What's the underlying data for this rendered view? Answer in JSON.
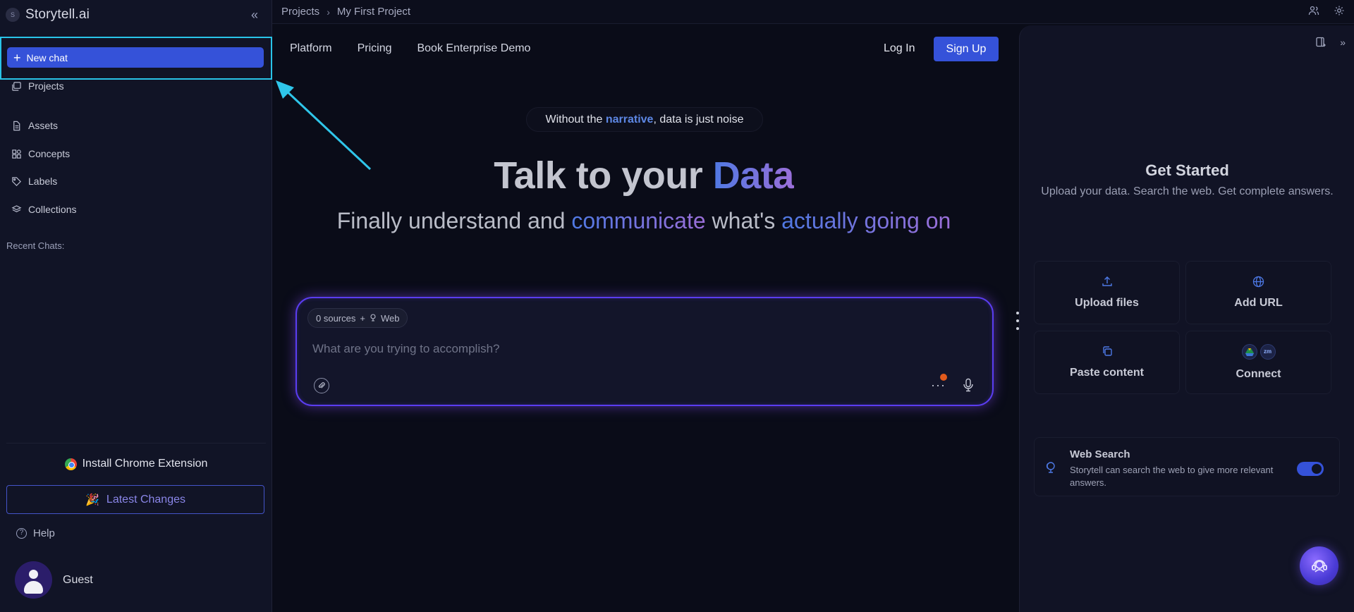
{
  "app": {
    "name": "Storytell.ai",
    "logo_text": "S"
  },
  "sidebar": {
    "new_chat_label": "New chat",
    "items": [
      {
        "label": "Projects",
        "icon": "folders-icon"
      },
      {
        "label": "Assets",
        "icon": "document-icon"
      },
      {
        "label": "Concepts",
        "icon": "grid-icon"
      },
      {
        "label": "Labels",
        "icon": "tag-icon"
      },
      {
        "label": "Collections",
        "icon": "layers-icon"
      }
    ],
    "recent_chats_label": "Recent Chats:",
    "chrome_extension_label": "Install Chrome Extension",
    "latest_changes_label": "Latest Changes",
    "latest_changes_emoji": "🎉",
    "help_label": "Help",
    "user_name": "Guest"
  },
  "breadcrumb": {
    "root": "Projects",
    "current": "My First Project"
  },
  "main_nav": {
    "items": [
      "Platform",
      "Pricing",
      "Book Enterprise Demo"
    ],
    "login": "Log In",
    "signup": "Sign Up"
  },
  "hero": {
    "pill_prefix": "Without the ",
    "pill_highlight": "narrative",
    "pill_suffix": ", data is just noise",
    "title_prefix": "Talk to your ",
    "title_highlight": "Data",
    "subtitle_part1": "Finally understand and ",
    "subtitle_hl1": "communicate",
    "subtitle_part2": " what's ",
    "subtitle_hl2": "actually going on"
  },
  "composer": {
    "sources_count": "0 sources",
    "sources_plus": "+",
    "sources_web": "Web",
    "placeholder": "What are you trying to accomplish?"
  },
  "right_panel": {
    "title": "Get Started",
    "subtitle": "Upload your data. Search the web. Get complete answers.",
    "cards": {
      "upload": "Upload files",
      "url": "Add URL",
      "paste": "Paste content",
      "connect": "Connect",
      "connect_zoom": "zm"
    },
    "web_search": {
      "title": "Web Search",
      "description": "Storytell can search the web to give more relevant answers.",
      "enabled": true
    }
  },
  "colors": {
    "accent": "#3552d9",
    "highlight_box": "#29c4e8",
    "gradient_start": "#4f79e3",
    "gradient_end": "#9b6fd9"
  }
}
